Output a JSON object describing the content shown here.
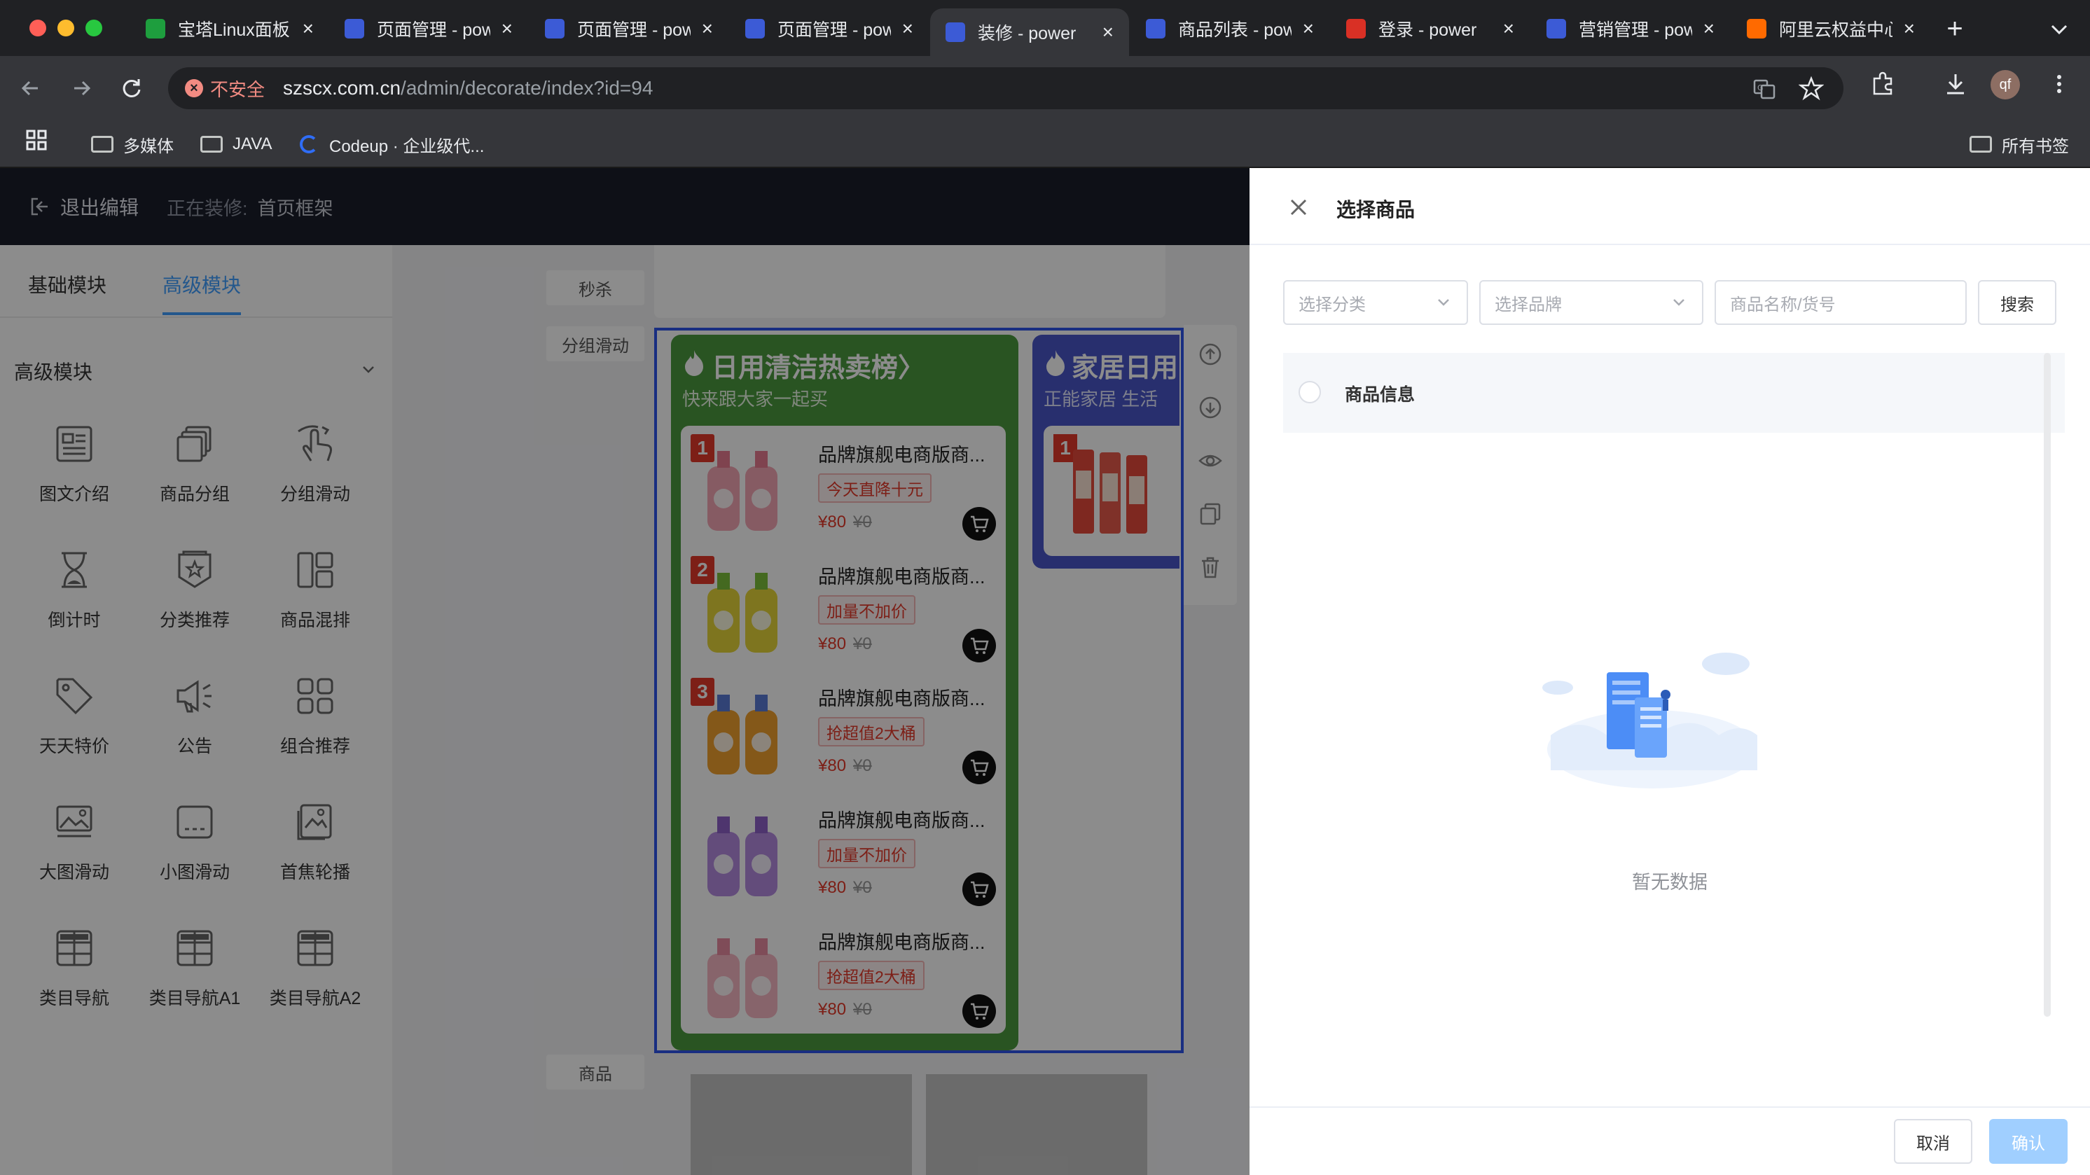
{
  "browser": {
    "tabs": [
      {
        "title": "宝塔Linux面板",
        "favicon_color": "#1e9e3e",
        "icon": "shield-icon"
      },
      {
        "title": "页面管理 - power",
        "favicon_color": "#3c5bd6",
        "icon": "t-logo-icon"
      },
      {
        "title": "页面管理 - power",
        "favicon_color": "#3c5bd6",
        "icon": "t-logo-icon"
      },
      {
        "title": "页面管理 - power",
        "favicon_color": "#3c5bd6",
        "icon": "t-logo-icon"
      },
      {
        "title": "装修 - power",
        "favicon_color": "#3c5bd6",
        "icon": "t-logo-icon",
        "active": true
      },
      {
        "title": "商品列表 - power",
        "favicon_color": "#3c5bd6",
        "icon": "t-logo-icon"
      },
      {
        "title": "登录 - power",
        "favicon_color": "#d93025",
        "icon": "login-icon"
      },
      {
        "title": "营销管理 - power",
        "favicon_color": "#3c5bd6",
        "icon": "t-logo-icon"
      },
      {
        "title": "阿里云权益中心",
        "favicon_color": "#ff6a00",
        "icon": "aliyun-icon"
      }
    ],
    "new_tab_label": "+",
    "security_label": "不安全",
    "url_domain": "szscx.com.cn",
    "url_path": "/admin/decorate/index?id=94",
    "profile_initials": "qf",
    "bookmarks": [
      {
        "label": "多媒体",
        "icon": "folder-icon"
      },
      {
        "label": "JAVA",
        "icon": "folder-icon"
      },
      {
        "label": "Codeup · 企业级代...",
        "icon": "codeup-icon"
      }
    ],
    "all_bookmarks_label": "所有书签"
  },
  "editor": {
    "exit_label": "退出编辑",
    "editing_prefix": "正在装修:",
    "editing_page": "首页框架",
    "module_tabs": [
      "基础模块",
      "高级模块"
    ],
    "active_module_tab": 1,
    "section_title": "高级模块",
    "modules": [
      {
        "label": "图文介绍",
        "icon": "image-text-icon"
      },
      {
        "label": "商品分组",
        "icon": "product-group-icon"
      },
      {
        "label": "分组滑动",
        "icon": "swipe-hand-icon"
      },
      {
        "label": "倒计时",
        "icon": "hourglass-icon"
      },
      {
        "label": "分类推荐",
        "icon": "category-badge-icon"
      },
      {
        "label": "商品混排",
        "icon": "mixed-layout-icon"
      },
      {
        "label": "天天特价",
        "icon": "price-tag-icon"
      },
      {
        "label": "公告",
        "icon": "megaphone-icon"
      },
      {
        "label": "组合推荐",
        "icon": "four-squares-icon"
      },
      {
        "label": "大图滑动",
        "icon": "large-image-icon"
      },
      {
        "label": "小图滑动",
        "icon": "small-image-icon"
      },
      {
        "label": "首焦轮播",
        "icon": "carousel-icon"
      },
      {
        "label": "类目导航",
        "icon": "table-grid-icon"
      },
      {
        "label": "类目导航A1",
        "icon": "table-grid-icon"
      },
      {
        "label": "类目导航A2",
        "icon": "table-grid-icon"
      }
    ],
    "canvas_labels": [
      "秒杀",
      "分组滑动",
      "商品"
    ],
    "ranking_green": {
      "title": "日用清洁热卖榜",
      "arrow": "〉",
      "subtitle": "快来跟大家一起买",
      "products": [
        {
          "rank": "1",
          "name": "品牌旗舰电商版商...",
          "tag": "今天直降十元",
          "price": "¥80",
          "old_price": "¥0"
        },
        {
          "rank": "2",
          "name": "品牌旗舰电商版商...",
          "tag": "加量不加价",
          "price": "¥80",
          "old_price": "¥0"
        },
        {
          "rank": "3",
          "name": "品牌旗舰电商版商...",
          "tag": "抢超值2大桶",
          "price": "¥80",
          "old_price": "¥0"
        },
        {
          "rank": "",
          "name": "品牌旗舰电商版商...",
          "tag": "加量不加价",
          "price": "¥80",
          "old_price": "¥0"
        },
        {
          "rank": "",
          "name": "品牌旗舰电商版商...",
          "tag": "抢超值2大桶",
          "price": "¥80",
          "old_price": "¥0"
        }
      ]
    },
    "ranking_blue": {
      "title": "家居日用",
      "subtitle": "正能家居 生活",
      "first_rank": "1"
    },
    "toolbar_icons": [
      "move-up-icon",
      "move-down-icon",
      "eye-icon",
      "copy-icon",
      "trash-icon"
    ]
  },
  "drawer": {
    "title": "选择商品",
    "category_placeholder": "选择分类",
    "brand_placeholder": "选择品牌",
    "search_placeholder": "商品名称/货号",
    "search_button": "搜索",
    "table_header": "商品信息",
    "empty_text": "暂无数据",
    "cancel_button": "取消",
    "confirm_button": "确认",
    "colors": {
      "primary": "#409eff",
      "primary_light": "#a0cfff"
    }
  }
}
